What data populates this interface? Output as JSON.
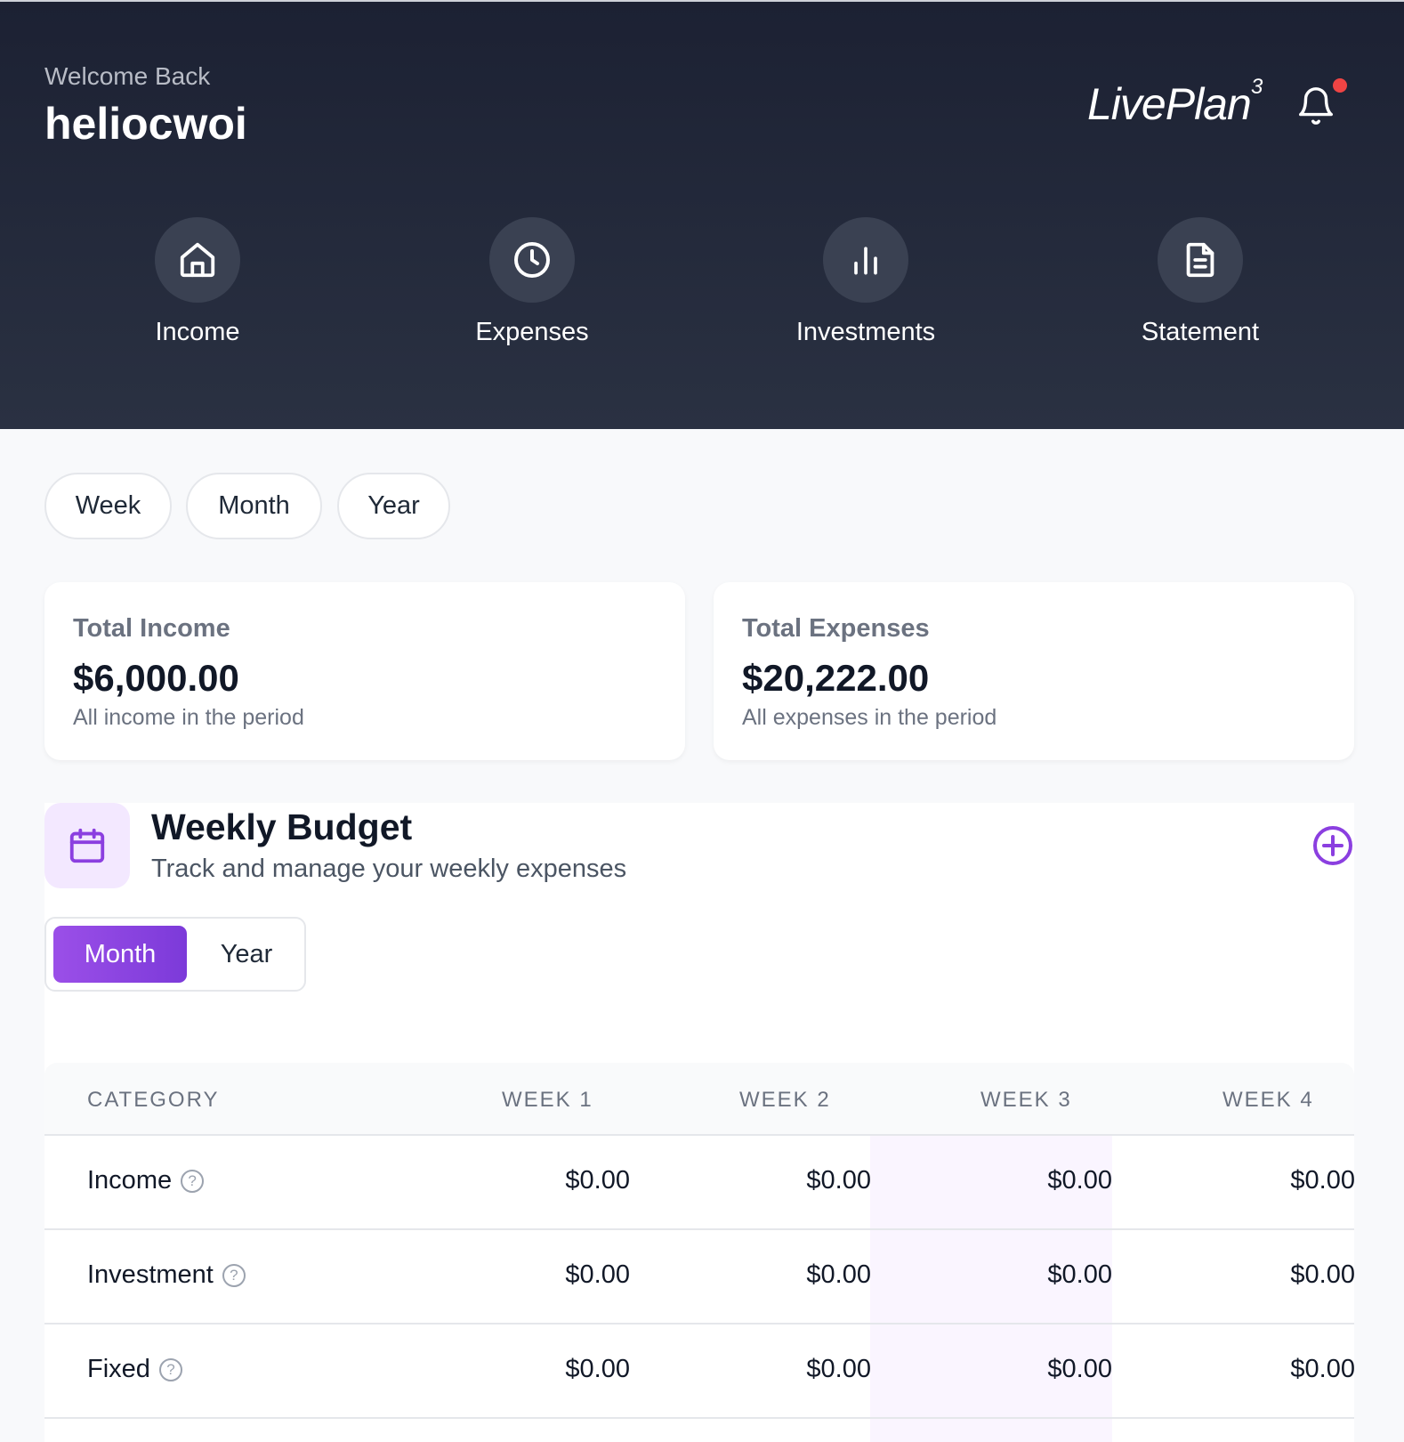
{
  "header": {
    "welcome": "Welcome Back",
    "username": "heliocwoi",
    "logo_text": "LivePlan",
    "logo_sup": "3",
    "notification_dot_color": "#ef4444"
  },
  "nav": {
    "items": [
      {
        "label": "Income",
        "icon": "home-icon"
      },
      {
        "label": "Expenses",
        "icon": "clock-icon"
      },
      {
        "label": "Investments",
        "icon": "bar-chart-icon"
      },
      {
        "label": "Statement",
        "icon": "document-icon"
      }
    ]
  },
  "period_filters": [
    "Week",
    "Month",
    "Year"
  ],
  "summary": {
    "income": {
      "title": "Total Income",
      "value": "$6,000.00",
      "subtitle": "All income in the period"
    },
    "expenses": {
      "title": "Total Expenses",
      "value": "$20,222.00",
      "subtitle": "All expenses in the period"
    }
  },
  "budget": {
    "title": "Weekly Budget",
    "subtitle": "Track and manage your weekly expenses",
    "toggle": {
      "active": "Month",
      "inactive": "Year"
    },
    "accent_color": "#7c3ad9",
    "table": {
      "headers": [
        "CATEGORY",
        "WEEK 1",
        "WEEK 2",
        "WEEK 3",
        "WEEK 4"
      ],
      "rows": [
        {
          "category": "Income",
          "values": [
            "$0.00",
            "$0.00",
            "$0.00",
            "$0.00"
          ]
        },
        {
          "category": "Investment",
          "values": [
            "$0.00",
            "$0.00",
            "$0.00",
            "$0.00"
          ]
        },
        {
          "category": "Fixed",
          "values": [
            "$0.00",
            "$0.00",
            "$0.00",
            "$0.00"
          ]
        }
      ]
    }
  }
}
